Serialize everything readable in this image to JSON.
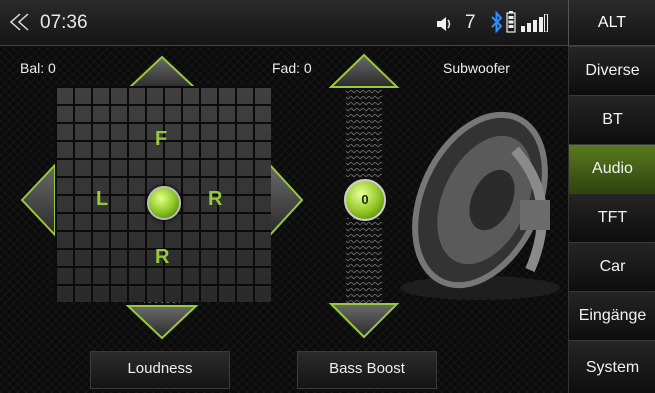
{
  "status": {
    "time": "07:36",
    "volume": "7",
    "alt_label": "ALT"
  },
  "labels": {
    "bal": "Bal: 0",
    "fad": "Fad: 0",
    "subwoofer": "Subwoofer"
  },
  "balance": {
    "front": "F",
    "rear": "R",
    "left": "L",
    "right": "R"
  },
  "fader": {
    "value": "0"
  },
  "buttons": {
    "loudness": "Loudness",
    "bass_boost": "Bass Boost"
  },
  "sidebar": {
    "items": [
      {
        "label": "Diverse"
      },
      {
        "label": "BT"
      },
      {
        "label": "Audio"
      },
      {
        "label": "TFT"
      },
      {
        "label": "Car"
      },
      {
        "label": "Eingänge"
      },
      {
        "label": "System"
      }
    ],
    "active_index": 2
  },
  "colors": {
    "accent": "#8fc521",
    "bluetooth": "#2f8fff"
  },
  "icons": [
    "back-icon",
    "volume-icon",
    "bluetooth-icon",
    "battery-icon",
    "signal-icon",
    "speaker-icon"
  ]
}
